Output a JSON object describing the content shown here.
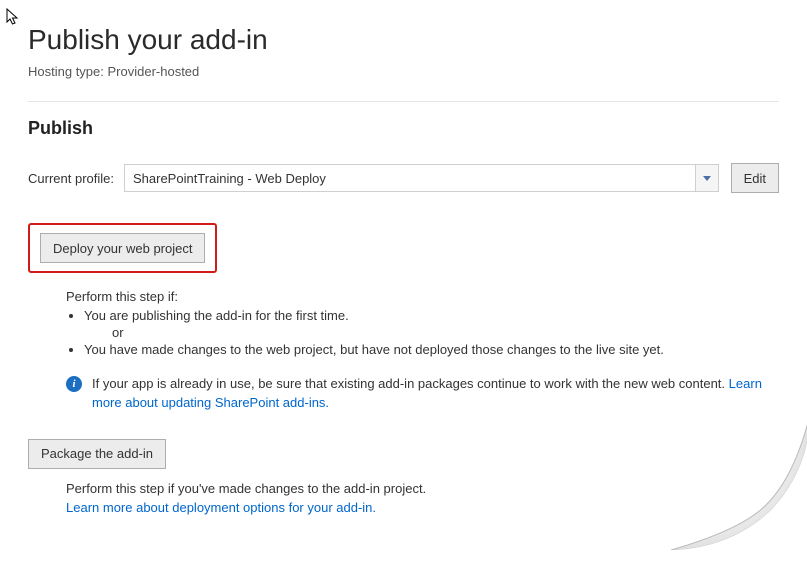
{
  "title": "Publish your add-in",
  "hosting": {
    "label": "Hosting type:",
    "value": "Provider-hosted"
  },
  "section_publish": "Publish",
  "profile": {
    "label": "Current profile:",
    "value": "SharePointTraining - Web Deploy",
    "edit_label": "Edit"
  },
  "deploy": {
    "button_label": "Deploy your web project",
    "perform_label": "Perform this step if:",
    "bullet1": "You are publishing the add-in for the first time.",
    "or_label": "or",
    "bullet2": "You have made changes to the web project, but have not deployed those changes to the live site yet.",
    "info_text": "If your app is already in use, be sure that existing add-in packages continue to work with the new web content.",
    "info_link": "Learn more about updating SharePoint add-ins."
  },
  "package": {
    "button_label": "Package the add-in",
    "perform_label": "Perform this step if you've made changes to the add-in project.",
    "link": "Learn more about deployment options for your add-in."
  }
}
